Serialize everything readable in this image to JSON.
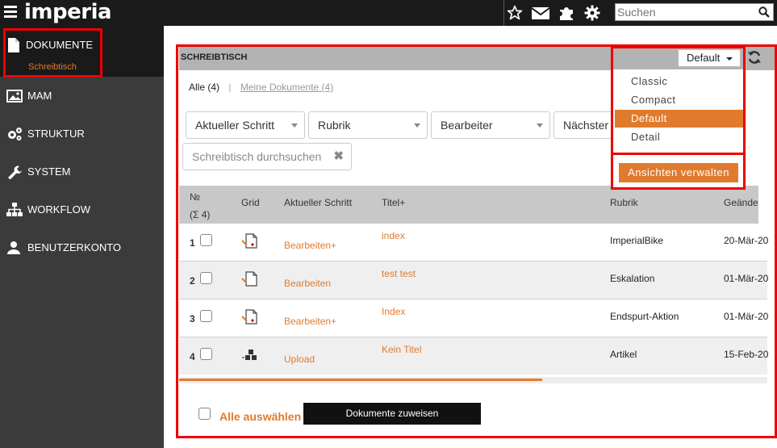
{
  "app": {
    "logo": "imperia"
  },
  "topbar": {
    "search_placeholder": "Suchen"
  },
  "sidebar": {
    "items": [
      {
        "label": "DOKUMENTE",
        "sub": "Schreibtisch"
      },
      {
        "label": "MAM"
      },
      {
        "label": "STRUKTUR"
      },
      {
        "label": "SYSTEM"
      },
      {
        "label": "WORKFLOW"
      },
      {
        "label": "BENUTZERKONTO"
      }
    ]
  },
  "panel": {
    "title": "SCHREIBTISCH",
    "tabs": {
      "all": "Alle (4)",
      "sep": "|",
      "mine": "Meine Dokumente (4)"
    },
    "filters": [
      "Aktueller Schritt",
      "Rubrik",
      "Bearbeiter",
      "Nächster"
    ],
    "search_placeholder": "Schreibtisch durchsuchen",
    "search_clear": "✖",
    "columns": {
      "num": "№",
      "num_count": "(Σ 4)",
      "grid": "Grid",
      "step": "Aktueller Schritt",
      "title": "Titel+",
      "rubrik": "Rubrik",
      "changed": "Geände"
    },
    "rows": [
      {
        "num": "1",
        "step": "Bearbeiten+",
        "title": "index",
        "rubrik": "ImperialBike",
        "changed": "20-Mär-20"
      },
      {
        "num": "2",
        "step": "Bearbeiten",
        "title": "test test",
        "rubrik": "Eskalation",
        "changed": "01-Mär-20"
      },
      {
        "num": "3",
        "step": "Bearbeiten+",
        "title": "Index",
        "rubrik": "Endspurt-Aktion",
        "changed": "01-Mär-20"
      },
      {
        "num": "4",
        "step": "Upload",
        "title": "Kein Titel",
        "rubrik": "Artikel",
        "changed": "15-Feb-20"
      }
    ],
    "select_all": "Alle auswählen",
    "assign_button": "Dokumente zuweisen"
  },
  "view_menu": {
    "current": "Default",
    "options": [
      "Classic",
      "Compact",
      "Default",
      "Detail"
    ],
    "selected_index": 2,
    "manage_button": "Ansichten verwalten"
  },
  "colors": {
    "accent": "#e07b2e",
    "topbar": "#1a1a1a",
    "sidebar": "#3b3b3b",
    "highlight": "#ee0000"
  }
}
